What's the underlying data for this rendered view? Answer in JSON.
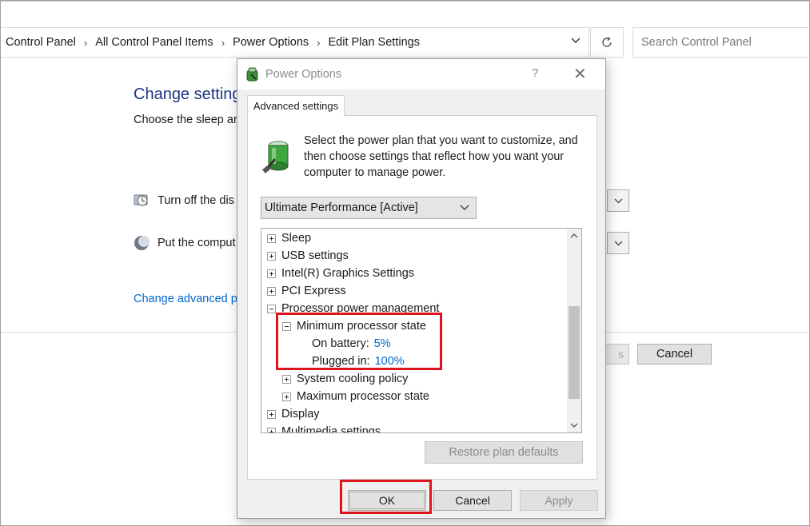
{
  "address_bar": {
    "breadcrumbs": [
      "Control Panel",
      "All Control Panel Items",
      "Power Options",
      "Edit Plan Settings"
    ],
    "search_placeholder": "Search Control Panel"
  },
  "background_page": {
    "title": "Change setting",
    "subtitle": "Choose the sleep ar",
    "display_label": "Turn off the dis",
    "sleep_label": "Put the comput",
    "advanced_link": "Change advanced p",
    "save_button_partial": "s",
    "cancel_button": "Cancel"
  },
  "dialog": {
    "title": "Power Options",
    "help_glyph": "?",
    "close_glyph": "✕",
    "tab_label": "Advanced settings",
    "intro_text": "Select the power plan that you want to customize, and then choose settings that reflect how you want your computer to manage power.",
    "plan_selected": "Ultimate Performance [Active]",
    "tree": [
      {
        "label": "Sleep",
        "expander": "plus",
        "indent": 0
      },
      {
        "label": "USB settings",
        "expander": "plus",
        "indent": 0
      },
      {
        "label": "Intel(R) Graphics Settings",
        "expander": "plus",
        "indent": 0
      },
      {
        "label": "PCI Express",
        "expander": "plus",
        "indent": 0
      },
      {
        "label": "Processor power management",
        "expander": "minus",
        "indent": 0
      },
      {
        "label": "Minimum processor state",
        "expander": "minus",
        "indent": 1
      },
      {
        "label": "On battery:",
        "value": "5%",
        "indent": 2
      },
      {
        "label": "Plugged in:",
        "value": "100%",
        "indent": 2
      },
      {
        "label": "System cooling policy",
        "expander": "plus",
        "indent": 1
      },
      {
        "label": "Maximum processor state",
        "expander": "plus",
        "indent": 1
      },
      {
        "label": "Display",
        "expander": "plus",
        "indent": 0
      },
      {
        "label": "Multimedia settings",
        "expander": "plus",
        "indent": 0
      }
    ],
    "restore_button": "Restore plan defaults",
    "ok_button": "OK",
    "cancel_button": "Cancel",
    "apply_button": "Apply"
  },
  "colors": {
    "highlight": "#e0141b",
    "link": "#0066cc",
    "title_blue": "#1e3287"
  }
}
